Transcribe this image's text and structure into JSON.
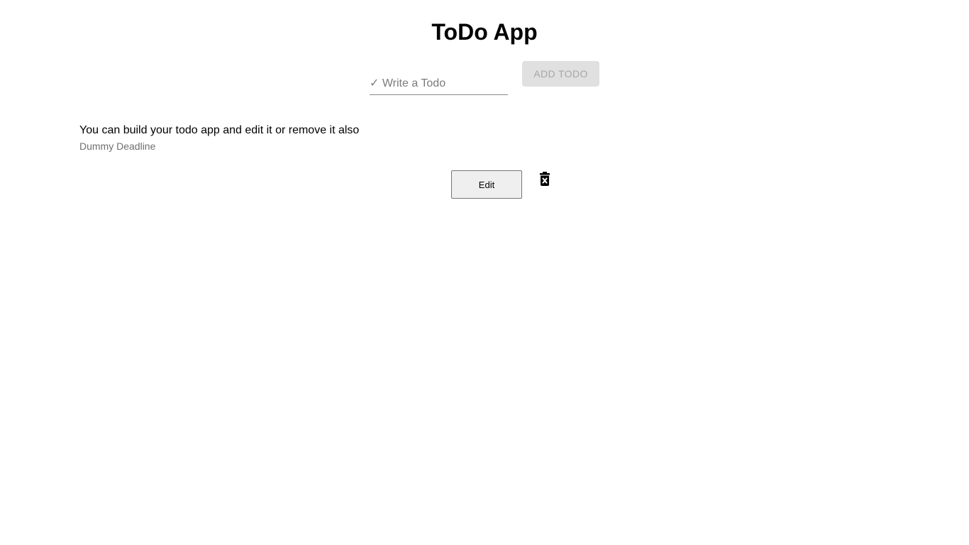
{
  "header": {
    "title": "ToDo App"
  },
  "form": {
    "input_placeholder": "✓ Write a Todo",
    "input_value": "",
    "add_button_label": "ADD TODO"
  },
  "todos": [
    {
      "text": "You can build your todo app and edit it or remove it also",
      "deadline": "Dummy Deadline",
      "edit_label": "Edit",
      "delete_icon": "trash-x-icon"
    }
  ],
  "colors": {
    "add_button_bg": "#e0e0e0",
    "add_button_text": "#a6a6a6",
    "deadline_text": "#6f6f6f"
  }
}
